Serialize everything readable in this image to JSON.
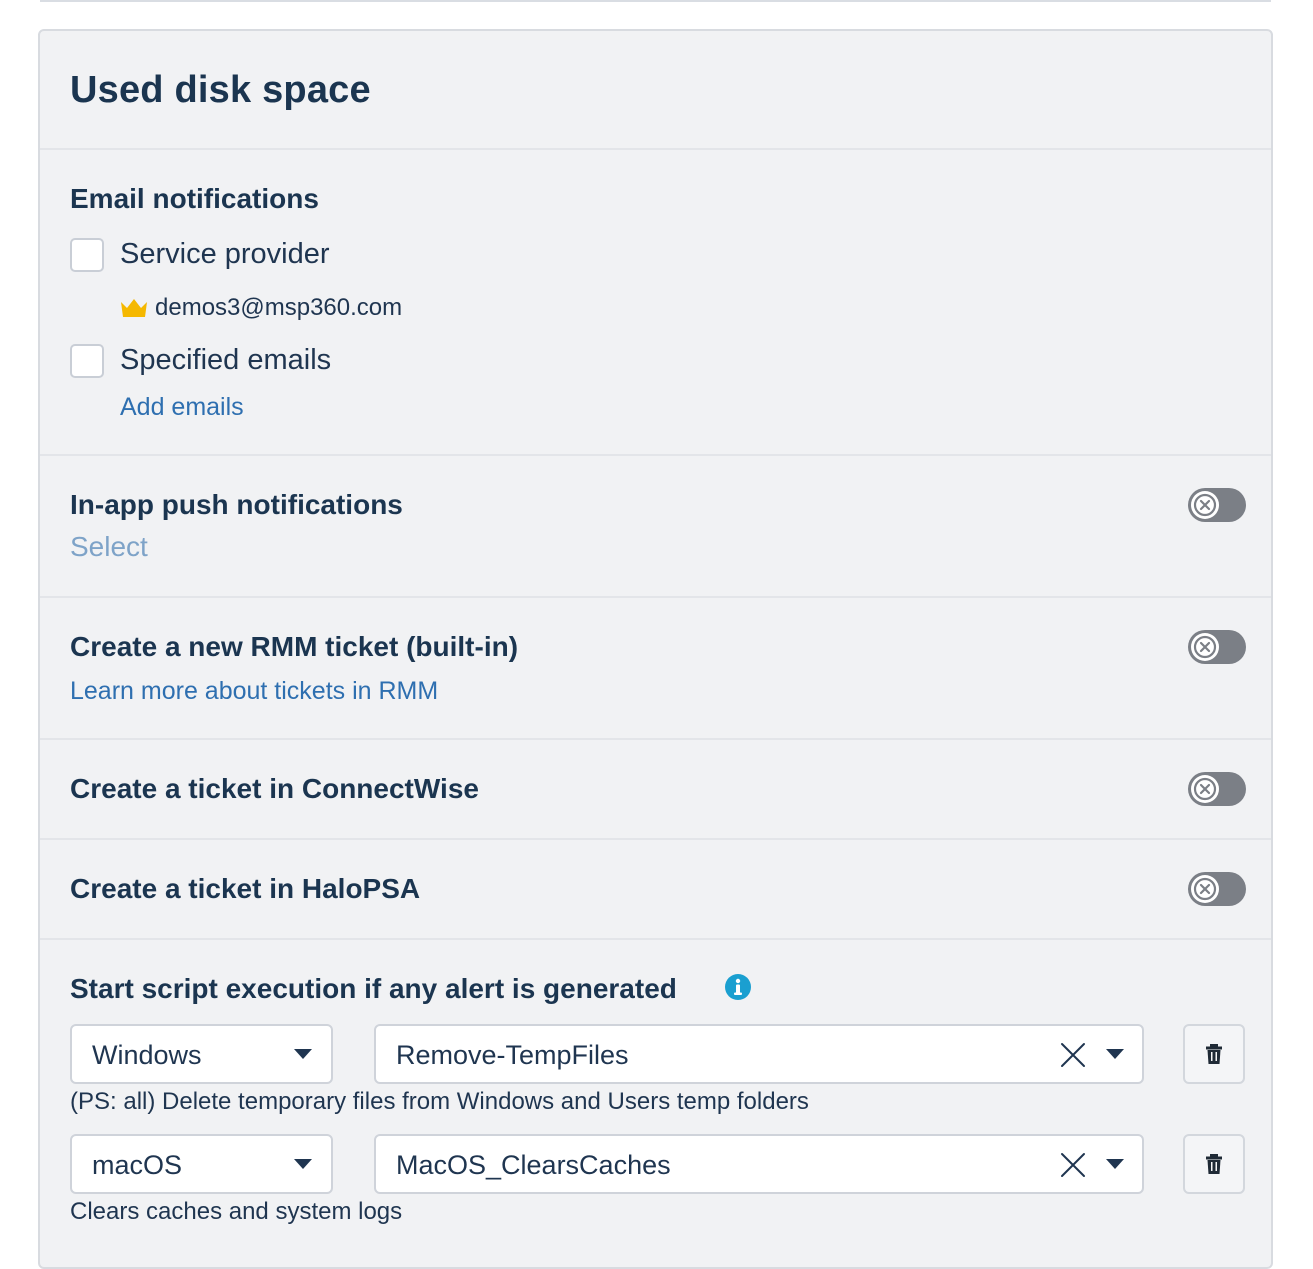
{
  "card": {
    "title": "Used disk space"
  },
  "email_notifications": {
    "title": "Email notifications",
    "service_provider_label": "Service provider",
    "provider_email": "demos3@msp360.com",
    "specified_emails_label": "Specified emails",
    "add_emails_link": "Add emails"
  },
  "in_app": {
    "title": "In-app push notifications",
    "select_link": "Select",
    "enabled": false
  },
  "rmm_ticket": {
    "title": "Create a new RMM ticket (built-in)",
    "learn_more_link": "Learn more about tickets in RMM",
    "enabled": false
  },
  "connectwise": {
    "title": "Create a ticket in ConnectWise",
    "enabled": false
  },
  "halopsa": {
    "title": "Create a ticket in HaloPSA",
    "enabled": false
  },
  "scripts": {
    "title": "Start script execution if any alert is generated",
    "rows": [
      {
        "os": "Windows",
        "script": "Remove-TempFiles",
        "description": "(PS: all) Delete temporary files from Windows and Users temp folders"
      },
      {
        "os": "macOS",
        "script": "MacOS_ClearsCaches",
        "description": "Clears caches and system logs"
      }
    ]
  },
  "icons": {
    "crown": "crown-icon",
    "info": "info-icon",
    "toggle_off": "x-circle-icon",
    "clear": "close-icon",
    "dropdown": "chevron-down-icon",
    "delete": "trash-icon"
  },
  "colors": {
    "link": "#2e6fb0",
    "crown": "#f5b800",
    "info": "#1a9fd0",
    "toggle_off": "#7b7f86"
  }
}
